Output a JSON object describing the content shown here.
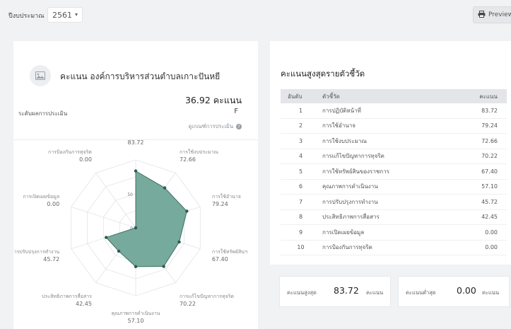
{
  "topbar": {
    "fiscal_year_label": "ปีงบประมาณ",
    "fiscal_year_value": "2561",
    "preview_label": "Preview"
  },
  "summary": {
    "title": "คะแนน องค์การบริหารส่วนตำบลเกาะปันหยี",
    "score_value": "36.92",
    "score_unit": "คะแนน",
    "level_label": "ระดับผลการประเมิน",
    "grade": "F",
    "criteria_link": "ดูเกณฑ์การประเมิน"
  },
  "chart_data": {
    "type": "radar",
    "axis_max": 100,
    "grid_levels": [
      50
    ],
    "tick_labels": [
      "0",
      "50"
    ],
    "axes": [
      {
        "label": "การปฏิบัติหน้าที่",
        "value": 83.72,
        "value_text": "83.72"
      },
      {
        "label": "การใช้งบประมาณ",
        "value": 72.66,
        "value_text": "72.66"
      },
      {
        "label": "การใช้อำนาจ",
        "value": 79.24,
        "value_text": "79.24"
      },
      {
        "label": "การใช้ทรัพย์สินฯ",
        "value": 67.4,
        "value_text": "67.40"
      },
      {
        "label": "การแก้ไขปัญหาการทุจริต",
        "value": 70.22,
        "value_text": "70.22"
      },
      {
        "label": "คุณภาพการดำเนินงาน",
        "value": 57.1,
        "value_text": "57.10"
      },
      {
        "label": "ประสิทธิภาพการสื่อสาร",
        "value": 42.45,
        "value_text": "42.45"
      },
      {
        "label": "การปรับปรุงการทำงาน",
        "value": 45.72,
        "value_text": "45.72"
      },
      {
        "label": "การเปิดเผยข้อมูล",
        "value": 0.0,
        "value_text": "0.00"
      },
      {
        "label": "การป้องกันการทุจริต",
        "value": 0.0,
        "value_text": "0.00"
      }
    ],
    "fill_color": "#6fa598",
    "stroke_color": "#3f6f63",
    "point_color": "#2f5a4f"
  },
  "ranking": {
    "title": "คะแนนสูงสุดรายตัวชี้วัด",
    "columns": [
      "อันดับ",
      "ตัวชี้วัด",
      "คะแนน"
    ],
    "rows": [
      {
        "rank": "1",
        "name": "การปฏิบัติหน้าที่",
        "score": "83.72"
      },
      {
        "rank": "2",
        "name": "การใช้อำนาจ",
        "score": "79.24"
      },
      {
        "rank": "3",
        "name": "การใช้งบประมาณ",
        "score": "72.66"
      },
      {
        "rank": "4",
        "name": "การแก้ไขปัญหาการทุจริต",
        "score": "70.22"
      },
      {
        "rank": "5",
        "name": "การใช้ทรัพย์สินของราชการ",
        "score": "67.40"
      },
      {
        "rank": "6",
        "name": "คุณภาพการดำเนินงาน",
        "score": "57.10"
      },
      {
        "rank": "7",
        "name": "การปรับปรุงการทำงาน",
        "score": "45.72"
      },
      {
        "rank": "8",
        "name": "ประสิทธิภาพการสื่อสาร",
        "score": "42.45"
      },
      {
        "rank": "9",
        "name": "การเปิดเผยข้อมูล",
        "score": "0.00"
      },
      {
        "rank": "10",
        "name": "การป้องกันการทุจริต",
        "score": "0.00"
      }
    ]
  },
  "stats": {
    "max_label": "คะแนนสูงสุด",
    "max_value": "83.72",
    "min_label": "คะแนนต่ำสุด",
    "min_value": "0.00",
    "unit": "คะแนน"
  }
}
